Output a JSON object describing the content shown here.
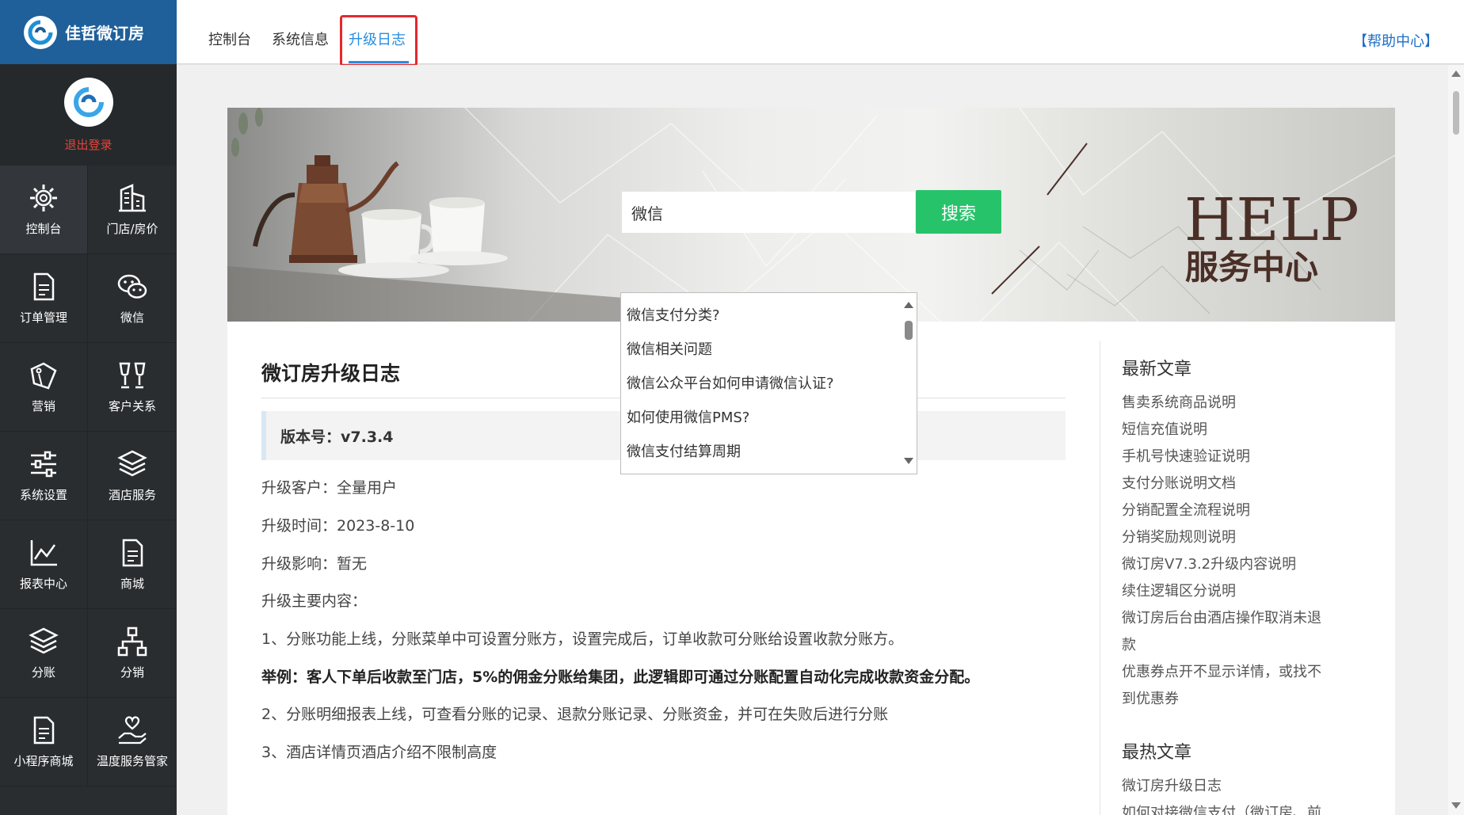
{
  "brand": {
    "name": "佳哲微订房"
  },
  "user": {
    "logout_label": "退出登录"
  },
  "sidebar": {
    "items": [
      {
        "label": "控制台",
        "icon": "gear-icon"
      },
      {
        "label": "门店/房价",
        "icon": "building-icon"
      },
      {
        "label": "订单管理",
        "icon": "document-icon"
      },
      {
        "label": "微信",
        "icon": "wechat-icon"
      },
      {
        "label": "营销",
        "icon": "tag-icon"
      },
      {
        "label": "客户关系",
        "icon": "wine-glasses-icon"
      },
      {
        "label": "系统设置",
        "icon": "sliders-icon"
      },
      {
        "label": "酒店服务",
        "icon": "layers-icon"
      },
      {
        "label": "报表中心",
        "icon": "line-chart-icon"
      },
      {
        "label": "商城",
        "icon": "document-icon"
      },
      {
        "label": "分账",
        "icon": "layers-icon"
      },
      {
        "label": "分销",
        "icon": "org-chart-icon"
      },
      {
        "label": "小程序商城",
        "icon": "document-icon"
      },
      {
        "label": "温度服务管家",
        "icon": "heart-hand-icon"
      }
    ]
  },
  "topbar": {
    "tabs": [
      {
        "label": "控制台"
      },
      {
        "label": "系统信息"
      },
      {
        "label": "升级日志"
      }
    ],
    "help_link": "【帮助中心】"
  },
  "banner": {
    "search_value": "微信",
    "search_button": "搜索",
    "help_en": "HELP",
    "help_cn": "服务中心"
  },
  "autocomplete": {
    "items": [
      "微信支付分类?",
      "微信相关问题",
      "微信公众平台如何申请微信认证?",
      "如何使用微信PMS?",
      "微信支付结算周期"
    ]
  },
  "article": {
    "title": "微订房升级日志",
    "version": "版本号：v7.3.4",
    "customers": "升级客户：全量用户",
    "time": "升级时间：2023-8-10",
    "impact": "升级影响：暂无",
    "content_heading": "升级主要内容：",
    "item1": "1、分账功能上线，分账菜单中可设置分账方，设置完成后，订单收款可分账给设置收款分账方。",
    "example": "举例：客人下单后收款至门店，5%的佣金分账给集团，此逻辑即可通过分账配置自动化完成收款资金分配。",
    "item2": "2、分账明细报表上线，可查看分账的记录、退款分账记录、分账资金，并可在失败后进行分账",
    "item3": "3、酒店详情页酒店介绍不限制高度"
  },
  "side": {
    "latest_heading": "最新文章",
    "latest": [
      "售卖系统商品说明",
      "短信充值说明",
      "手机号快速验证说明",
      "支付分账说明文档",
      "分销配置全流程说明",
      "分销奖励规则说明",
      "微订房V7.3.2升级内容说明",
      "续住逻辑区分说明",
      "微订房后台由酒店操作取消未退",
      "款",
      "优惠券点开不显示详情，或找不",
      "到优惠券"
    ],
    "hot_heading": "最热文章",
    "hot": [
      "微订房升级日志",
      "如何对接微信支付（微订房、前"
    ]
  },
  "colors": {
    "brand_blue": "#1f5f9a",
    "sidebar_bg": "#2a2d30",
    "accent": "#2a8de0",
    "search_green": "#27c36b",
    "highlight_red": "#e5282d",
    "logout_red": "#e5433a"
  }
}
